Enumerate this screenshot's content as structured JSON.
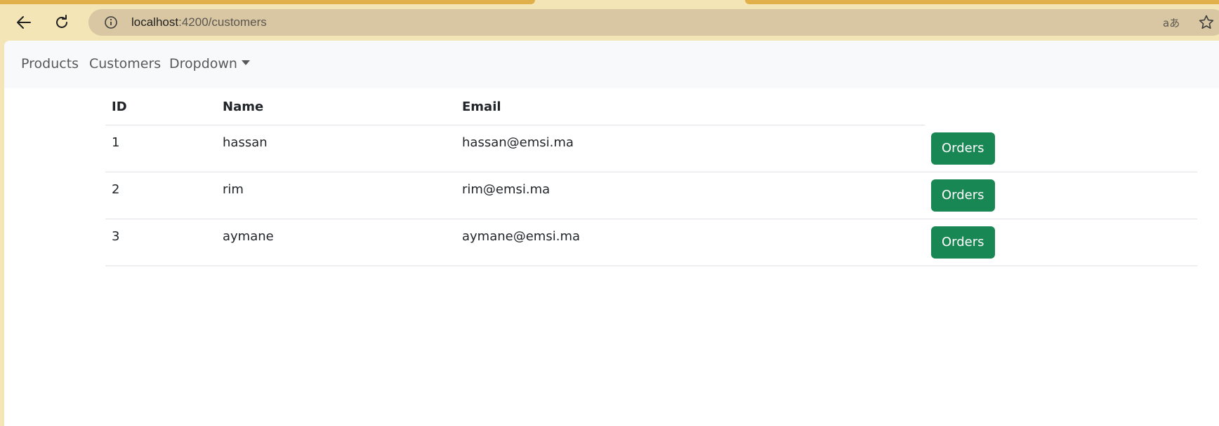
{
  "browser": {
    "url_host": "localhost",
    "url_path": ":4200/customers",
    "back_icon": "arrow-left-icon",
    "reload_icon": "reload-icon",
    "info_icon": "info-icon",
    "translate_label": "aあ",
    "star_icon": "star-icon"
  },
  "navbar": {
    "links": [
      "Products",
      "Customers"
    ],
    "dropdown_label": "Dropdown"
  },
  "table": {
    "headers": [
      "ID",
      "Name",
      "Email"
    ],
    "rows": [
      {
        "id": "1",
        "name": "hassan",
        "email": "hassan@emsi.ma",
        "action": "Orders"
      },
      {
        "id": "2",
        "name": "rim",
        "email": "rim@emsi.ma",
        "action": "Orders"
      },
      {
        "id": "3",
        "name": "aymane",
        "email": "aymane@emsi.ma",
        "action": "Orders"
      }
    ]
  },
  "colors": {
    "button": "#198754",
    "chrome": "#f3e5b5",
    "omnibox": "#d8c7a2",
    "navbar": "#f8f9fa"
  }
}
